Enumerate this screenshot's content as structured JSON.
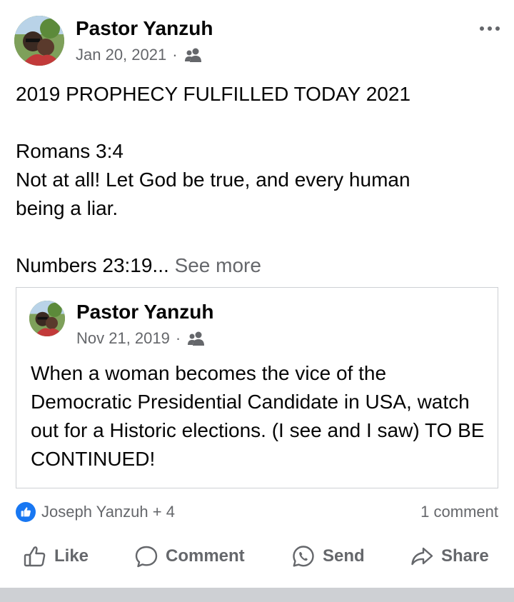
{
  "post": {
    "author": "Pastor Yanzuh",
    "date": "Jan 20, 2021",
    "separator": "·",
    "audience_icon": "friends-icon",
    "text": {
      "line1": "2019 PROPHECY FULFILLED TODAY 2021",
      "line2": "Romans 3:4",
      "line3": "Not at all! Let God be true, and every human being a liar.",
      "line4": "Numbers 23:19...",
      "see_more": "See more"
    }
  },
  "shared_post": {
    "author": "Pastor Yanzuh",
    "date": "Nov 21, 2019",
    "separator": "·",
    "audience_icon": "friends-icon",
    "text": "When a woman becomes the vice of the Democratic Presidential Candidate in USA, watch out for a Historic elections. (I see and I saw) TO BE CONTINUED!"
  },
  "reactions": {
    "reactors": "Joseph Yanzuh + 4",
    "comments": "1 comment",
    "like_color": "#1877f2"
  },
  "actions": {
    "like": "Like",
    "comment": "Comment",
    "send": "Send",
    "share": "Share"
  }
}
